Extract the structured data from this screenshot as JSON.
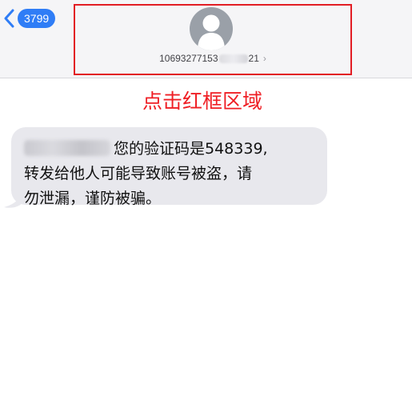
{
  "header": {
    "back_count": "3799",
    "contact_phone_prefix": "10693277153",
    "contact_phone_suffix": "21",
    "disclosure": "›"
  },
  "annotation": {
    "text": "点击红框区域",
    "color": "#ef1e24"
  },
  "message": {
    "line1": "您的验证码是548339,",
    "line2": "转发给他人可能导致账号被盗，请",
    "line3": "勿泄漏，谨防被骗。"
  },
  "icons": {
    "back": "chevron-left-icon",
    "avatar": "person-silhouette-icon"
  },
  "colors": {
    "accent": "#2f7df6",
    "highlight_border": "#e21d24",
    "bubble": "#e8e8ed",
    "header_bg": "#f5f5f7"
  }
}
